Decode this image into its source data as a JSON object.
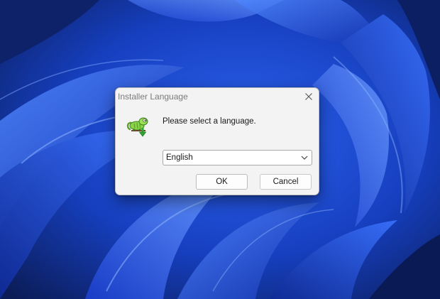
{
  "dialog": {
    "title": "Installer Language",
    "prompt": "Please select a language.",
    "language_select": {
      "selected": "English"
    },
    "ok_label": "OK",
    "cancel_label": "Cancel"
  },
  "icons": {
    "app": "notepad-plus-plus-chameleon-icon",
    "close": "close-icon",
    "dropdown": "chevron-down-icon"
  },
  "colors": {
    "dialog_bg": "#f3f3f3",
    "wallpaper_primary": "#1e4bd8",
    "wallpaper_dark": "#0a1f5c"
  }
}
